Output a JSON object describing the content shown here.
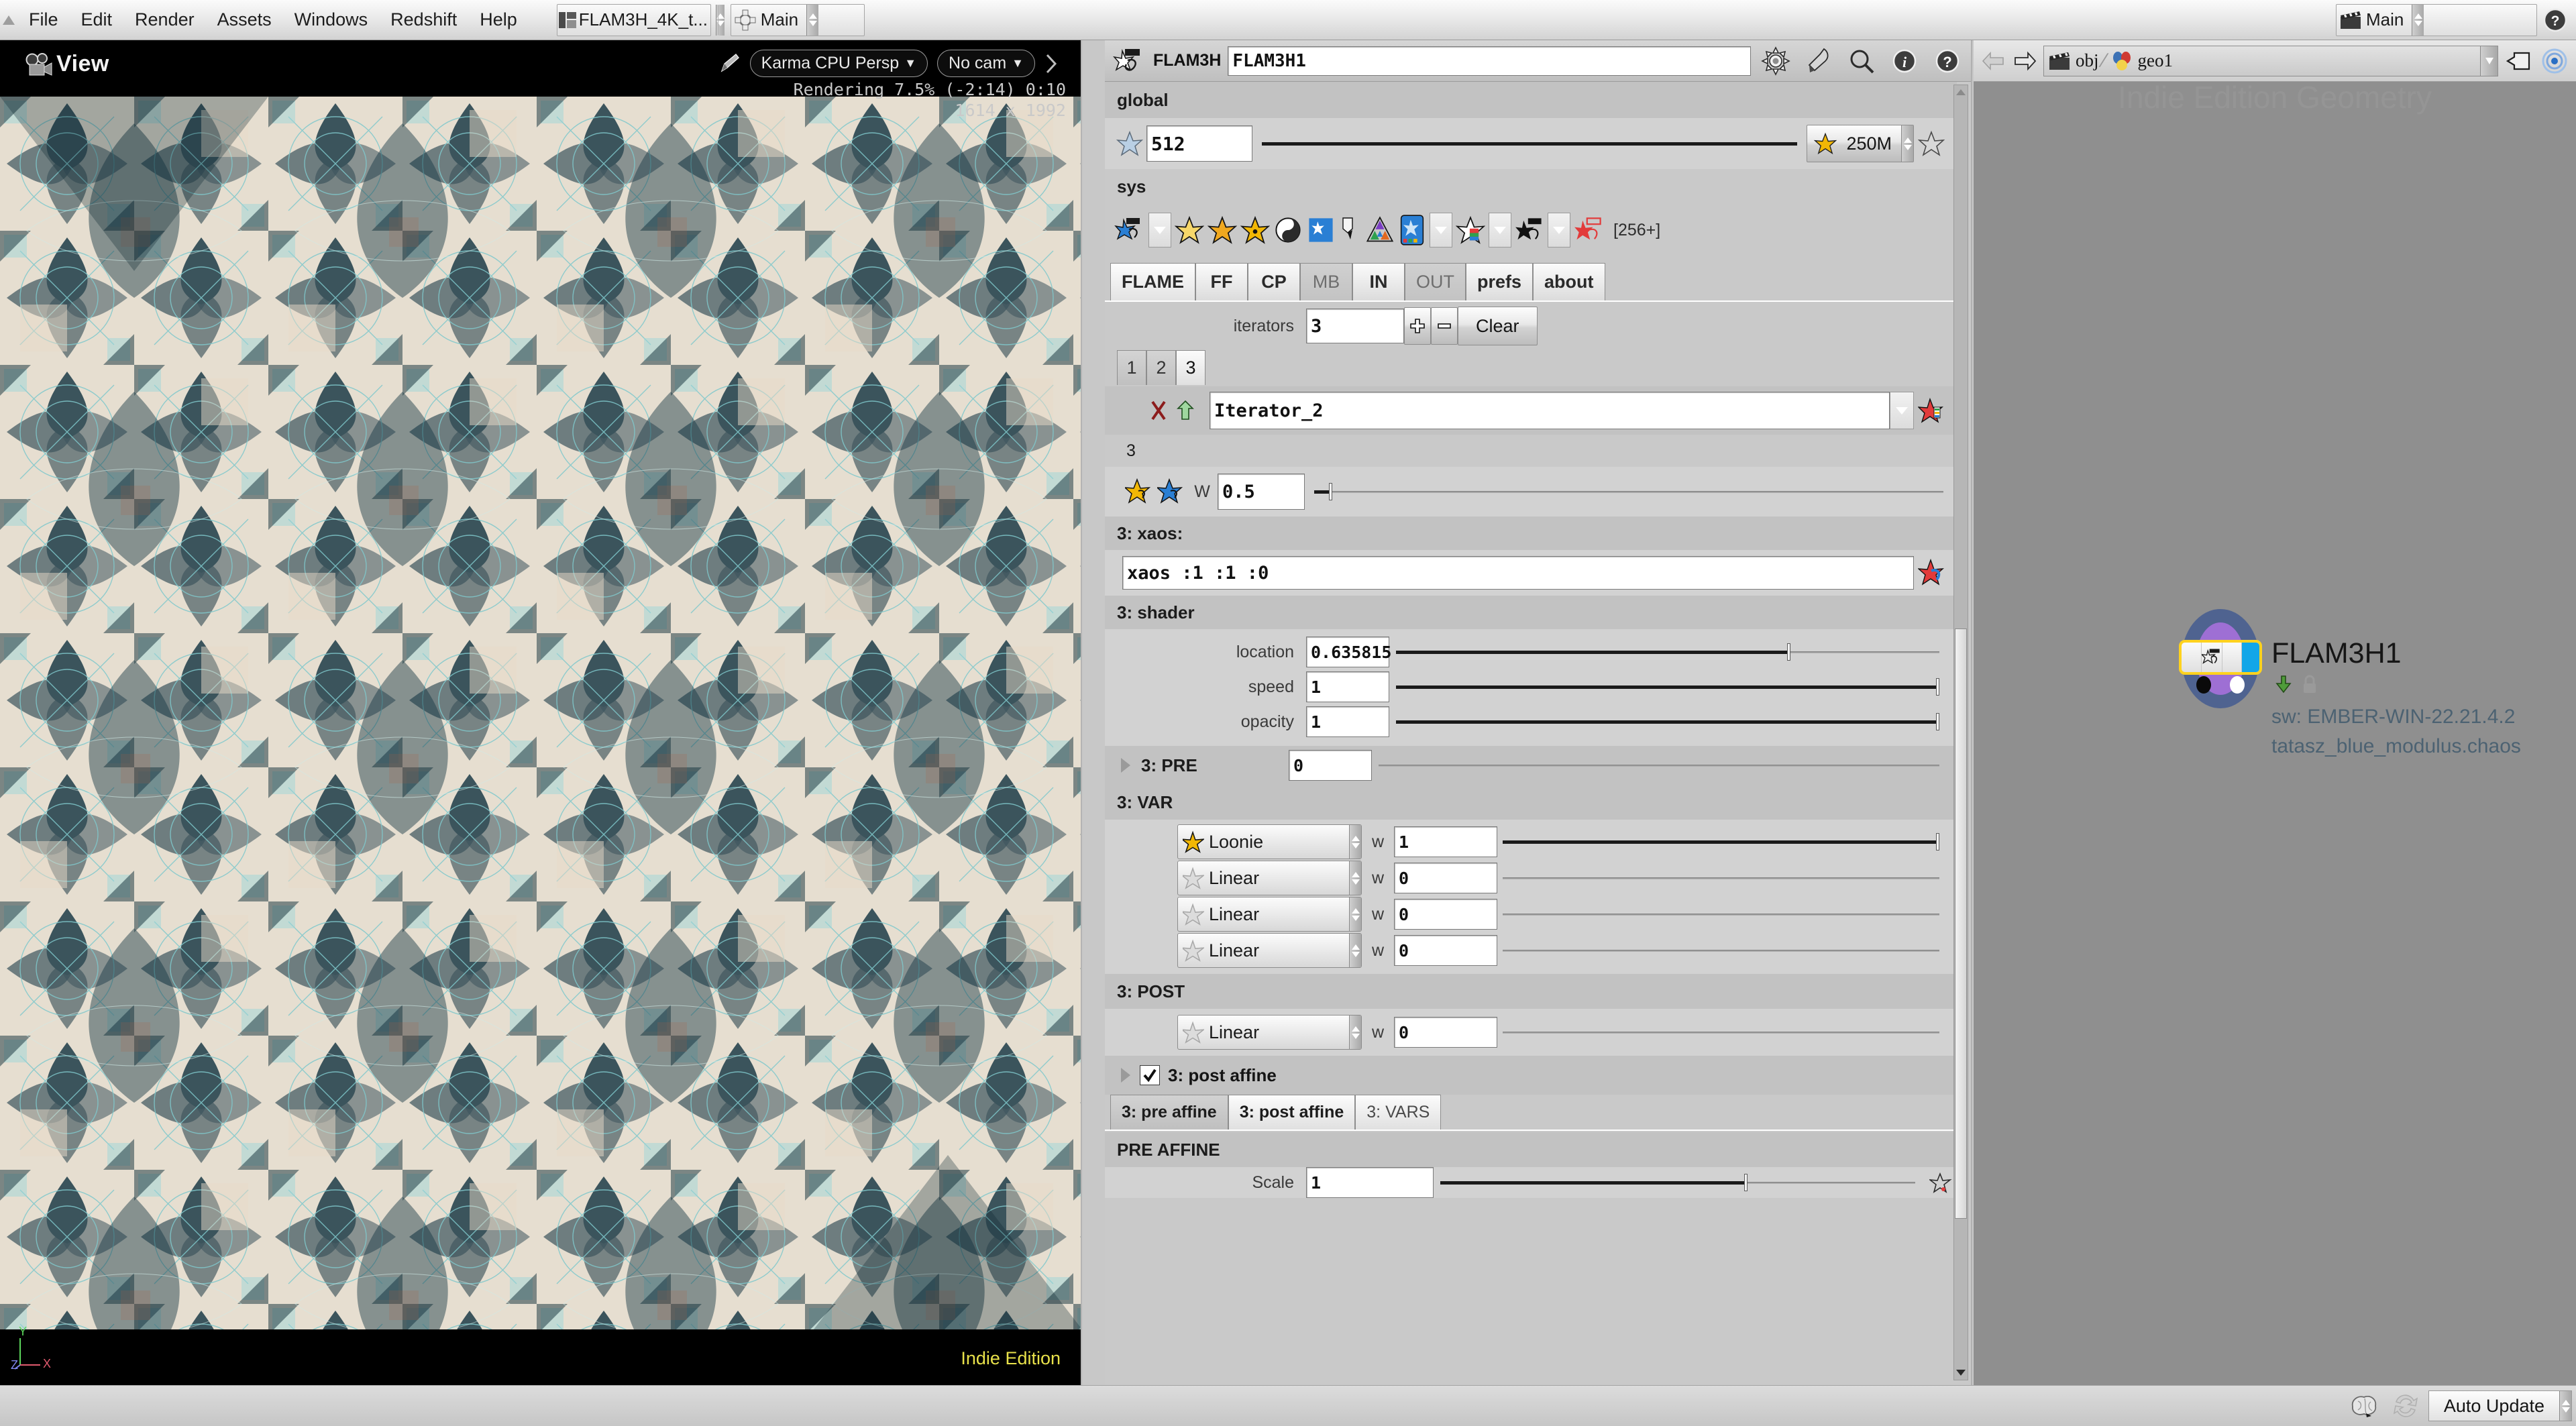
{
  "menubar": {
    "items": [
      "File",
      "Edit",
      "Render",
      "Assets",
      "Windows",
      "Redshift",
      "Help"
    ],
    "desktop_chip": {
      "label": "FLAM3H_4K_t..."
    },
    "pane_chip": {
      "label": "Main"
    },
    "right_chip": {
      "label": "Main"
    }
  },
  "viewport": {
    "title": "View",
    "renderer_pill": "Karma CPU  Persp",
    "camera_pill": "No cam",
    "status_line": "Rendering  7.5%   (-2:14)    0:10",
    "resolution": "1614 x 1992",
    "watermark": "Indie Edition",
    "axis": {
      "y": "Y",
      "z": "Z",
      "x": "X"
    }
  },
  "flam3h": {
    "node_label": "FLAM3H",
    "node_name": "FLAM3H1",
    "toolbar_icons": [
      "gear-icon",
      "paint-icon",
      "search-icon",
      "info-icon",
      "help-icon"
    ],
    "global": {
      "header": "global",
      "iterations_value": "512",
      "points_value": "250M"
    },
    "sys": {
      "header": "sys",
      "palette_count": "[256+]"
    },
    "tabs": [
      {
        "label": "FLAME",
        "state": "selected"
      },
      {
        "label": "FF",
        "state": "normal"
      },
      {
        "label": "CP",
        "state": "normal"
      },
      {
        "label": "MB",
        "state": "dim"
      },
      {
        "label": "IN",
        "state": "normal"
      },
      {
        "label": "OUT",
        "state": "dim"
      },
      {
        "label": "prefs",
        "state": "normal"
      },
      {
        "label": "about",
        "state": "normal"
      }
    ],
    "iterators": {
      "label": "iterators",
      "value": "3",
      "add_label": "+",
      "remove_label": "-",
      "clear_label": "Clear",
      "index_tabs": [
        "1",
        "2",
        "3"
      ],
      "active_index": "3"
    },
    "iterator": {
      "name": "Iterator_2",
      "number_header": "3",
      "weight_label": "W",
      "weight_value": "0.5",
      "xaos_header": "3: xaos:",
      "xaos_value": "xaos :1 :1 :0",
      "shader_header": "3: shader",
      "shader": [
        {
          "label": "location",
          "value": "0.635815",
          "pos": 72
        },
        {
          "label": "speed",
          "value": "1",
          "pos": 100
        },
        {
          "label": "opacity",
          "value": "1",
          "pos": 100
        }
      ],
      "pre_header": "3: PRE",
      "pre_value": "0",
      "var_header": "3: VAR",
      "vars": [
        {
          "name": "Loonie",
          "w_label": "w",
          "w_value": "1",
          "active": true
        },
        {
          "name": "Linear",
          "w_label": "w",
          "w_value": "0",
          "active": false
        },
        {
          "name": "Linear",
          "w_label": "w",
          "w_value": "0",
          "active": false
        },
        {
          "name": "Linear",
          "w_label": "w",
          "w_value": "0",
          "active": false
        }
      ],
      "post_header": "3: POST",
      "post_vars": [
        {
          "name": "Linear",
          "w_label": "w",
          "w_value": "0",
          "active": false
        }
      ],
      "post_affine_toggle": {
        "label": "3: post affine",
        "checked": true
      },
      "affine_tabs": [
        {
          "label": "3: pre affine",
          "state": "selected"
        },
        {
          "label": "3: post affine",
          "state": "normal"
        },
        {
          "label": "3: VARS",
          "state": "dim"
        }
      ],
      "pre_affine": {
        "header": "PRE AFFINE",
        "scale_label": "Scale",
        "scale_value": "1"
      }
    }
  },
  "network": {
    "breadcrumb": [
      {
        "icon": "scene-icon",
        "label": "obj"
      },
      {
        "icon": "geo-icon",
        "label": "geo1"
      }
    ],
    "watermark": "Indie Edition  Geometry",
    "node": {
      "name": "FLAM3H1",
      "sw_line": "sw: EMBER-WIN-22.21.4.2",
      "preset_line": "tatasz_blue_modulus.chaos",
      "badges": [
        "render-flag-icon",
        "lock-icon"
      ]
    }
  },
  "statusbar": {
    "auto_update_label": "Auto Update",
    "icons": [
      "brain-icon",
      "recook-icon"
    ]
  },
  "colors": {
    "panel_bg": "#c9c9c9",
    "net_bg": "#8f8f8f",
    "accent_yellow": "#ffd21e",
    "accent_cyan": "#12a6e8",
    "node_purple": "#9e6fd4",
    "node_blue": "#4f6390",
    "indie_text": "#e8e14a",
    "sw_text": "#4c6272"
  }
}
